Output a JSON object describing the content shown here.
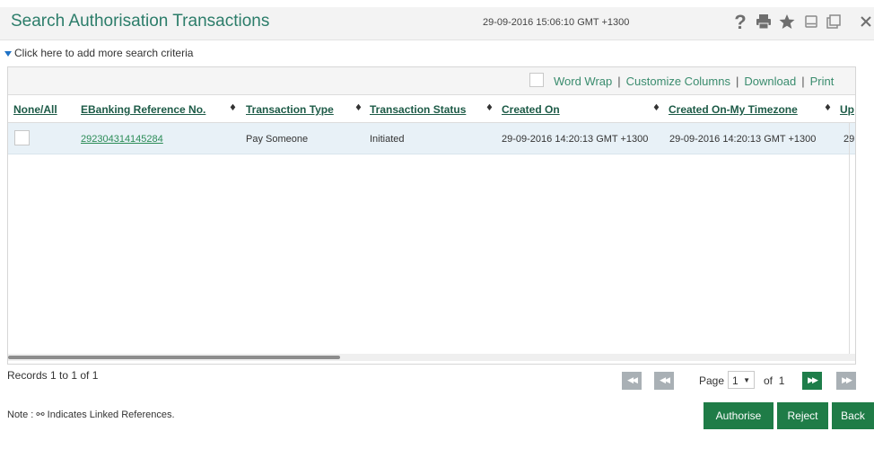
{
  "header": {
    "title": "Search Authorisation Transactions",
    "timestamp": "29-09-2016 15:06:10 GMT +1300",
    "icons": [
      "help-icon",
      "print-icon",
      "favorite-icon",
      "minimize-icon",
      "restore-icon",
      "close-icon"
    ]
  },
  "search_criteria_link": "Click here to add more search criteria",
  "toolbar": {
    "word_wrap": "Word Wrap",
    "customize_columns": "Customize Columns",
    "download": "Download",
    "print": "Print",
    "separator": "|"
  },
  "table": {
    "columns": [
      "None/All",
      "EBanking Reference No.",
      "Transaction Type",
      "Transaction Status",
      "Created On",
      "Created On-My Timezone",
      "Up"
    ],
    "rows": [
      {
        "reference": "292304314145284",
        "type": "Pay Someone",
        "status": "Initiated",
        "created_on": "29-09-2016 14:20:13 GMT +1300",
        "created_on_tz": "29-09-2016 14:20:13 GMT +1300",
        "updated": "29"
      }
    ]
  },
  "pagination": {
    "records": "Records 1 to 1 of 1",
    "page_label": "Page",
    "current_page": "1",
    "of_label": "of",
    "total_pages": "1"
  },
  "note": "Note : ⚯ Indicates Linked References.",
  "buttons": {
    "authorise": "Authorise",
    "reject": "Reject",
    "back": "Back"
  },
  "colors": {
    "accent": "#2c7d6a",
    "button": "#1f7c47",
    "row_highlight": "#e8f1f7"
  }
}
